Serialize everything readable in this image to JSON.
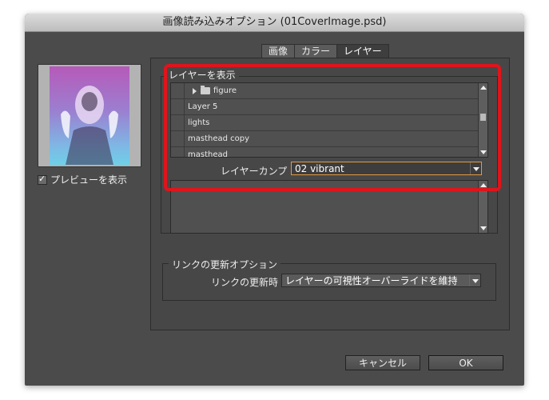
{
  "window": {
    "title": "画像読み込みオプション (01CoverImage.psd)"
  },
  "tabs": [
    {
      "label": "画像",
      "active": false
    },
    {
      "label": "カラー",
      "active": false
    },
    {
      "label": "レイヤー",
      "active": true
    }
  ],
  "preview": {
    "checkbox_label": "プレビューを表示",
    "checked": true
  },
  "layers_group": {
    "title": "レイヤーを表示",
    "items": [
      {
        "label": "figure",
        "type": "folder",
        "collapsed": true
      },
      {
        "label": "Layer 5",
        "type": "layer"
      },
      {
        "label": "lights",
        "type": "layer"
      },
      {
        "label": "masthead copy",
        "type": "layer"
      },
      {
        "label": "masthead",
        "type": "layer"
      }
    ],
    "comp_label": "レイヤーカンプ :",
    "comp_value": "02 vibrant"
  },
  "link_group": {
    "title": "リンクの更新オプション",
    "label": "リンクの更新時 :",
    "value": "レイヤーの可視性オーバーライドを維持"
  },
  "buttons": {
    "cancel": "キャンセル",
    "ok": "OK"
  },
  "colors": {
    "highlight_outline": "#e0141b",
    "focus_border": "#e19a43",
    "panel": "#4b4b4b"
  }
}
